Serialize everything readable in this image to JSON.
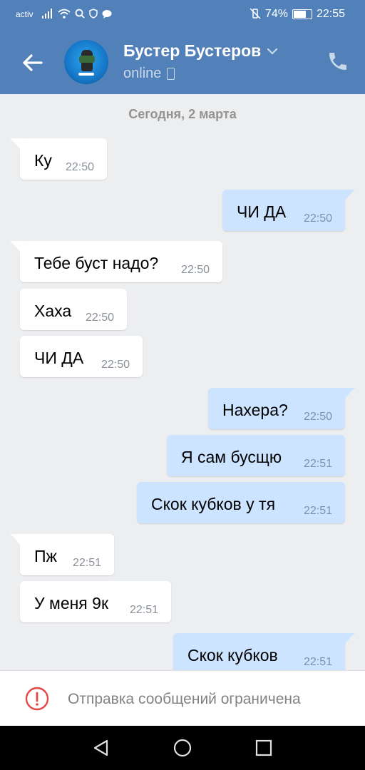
{
  "status_bar": {
    "carrier": "activ",
    "battery_text": "74%",
    "battery_level": 0.74,
    "time": "22:55"
  },
  "header": {
    "contact_name": "Бустер Бустеров",
    "presence": "online"
  },
  "chat": {
    "date_divider": "Сегодня, 2 марта",
    "messages": [
      {
        "dir": "in",
        "text": "Ку",
        "time": "22:50"
      },
      {
        "dir": "out",
        "text": "ЧИ ДА",
        "time": "22:50"
      },
      {
        "dir": "in",
        "text": "Тебе буст надо?",
        "time": "22:50"
      },
      {
        "dir": "in",
        "text": "Хаха",
        "time": "22:50"
      },
      {
        "dir": "in",
        "text": "ЧИ ДА",
        "time": "22:50"
      },
      {
        "dir": "out",
        "text": "Нахера?",
        "time": "22:50"
      },
      {
        "dir": "out",
        "text": "Я сам бусщю",
        "time": "22:51"
      },
      {
        "dir": "out",
        "text": "Скок кубков у тя",
        "time": "22:51"
      },
      {
        "dir": "in",
        "text": "Пж",
        "time": "22:51"
      },
      {
        "dir": "in",
        "text": "У меня 9к",
        "time": "22:51"
      },
      {
        "dir": "out",
        "text": "Скок кубков",
        "time": "22:51"
      }
    ]
  },
  "restriction_bar": {
    "text": "Отправка сообщений ограничена"
  },
  "colors": {
    "header_bg": "#5181b8",
    "chat_bg": "#edeef0",
    "incoming_bubble": "#ffffff",
    "outgoing_bubble": "#cce4ff",
    "warning_red": "#e64646"
  },
  "icons": {
    "back": "arrow-left-icon",
    "dropdown": "chevron-down-icon",
    "mobile": "mobile-phone-icon",
    "call": "phone-call-icon",
    "warning": "exclamation-circle-icon",
    "nav_back": "triangle-back-icon",
    "nav_home": "circle-home-icon",
    "nav_recents": "square-recents-icon"
  }
}
